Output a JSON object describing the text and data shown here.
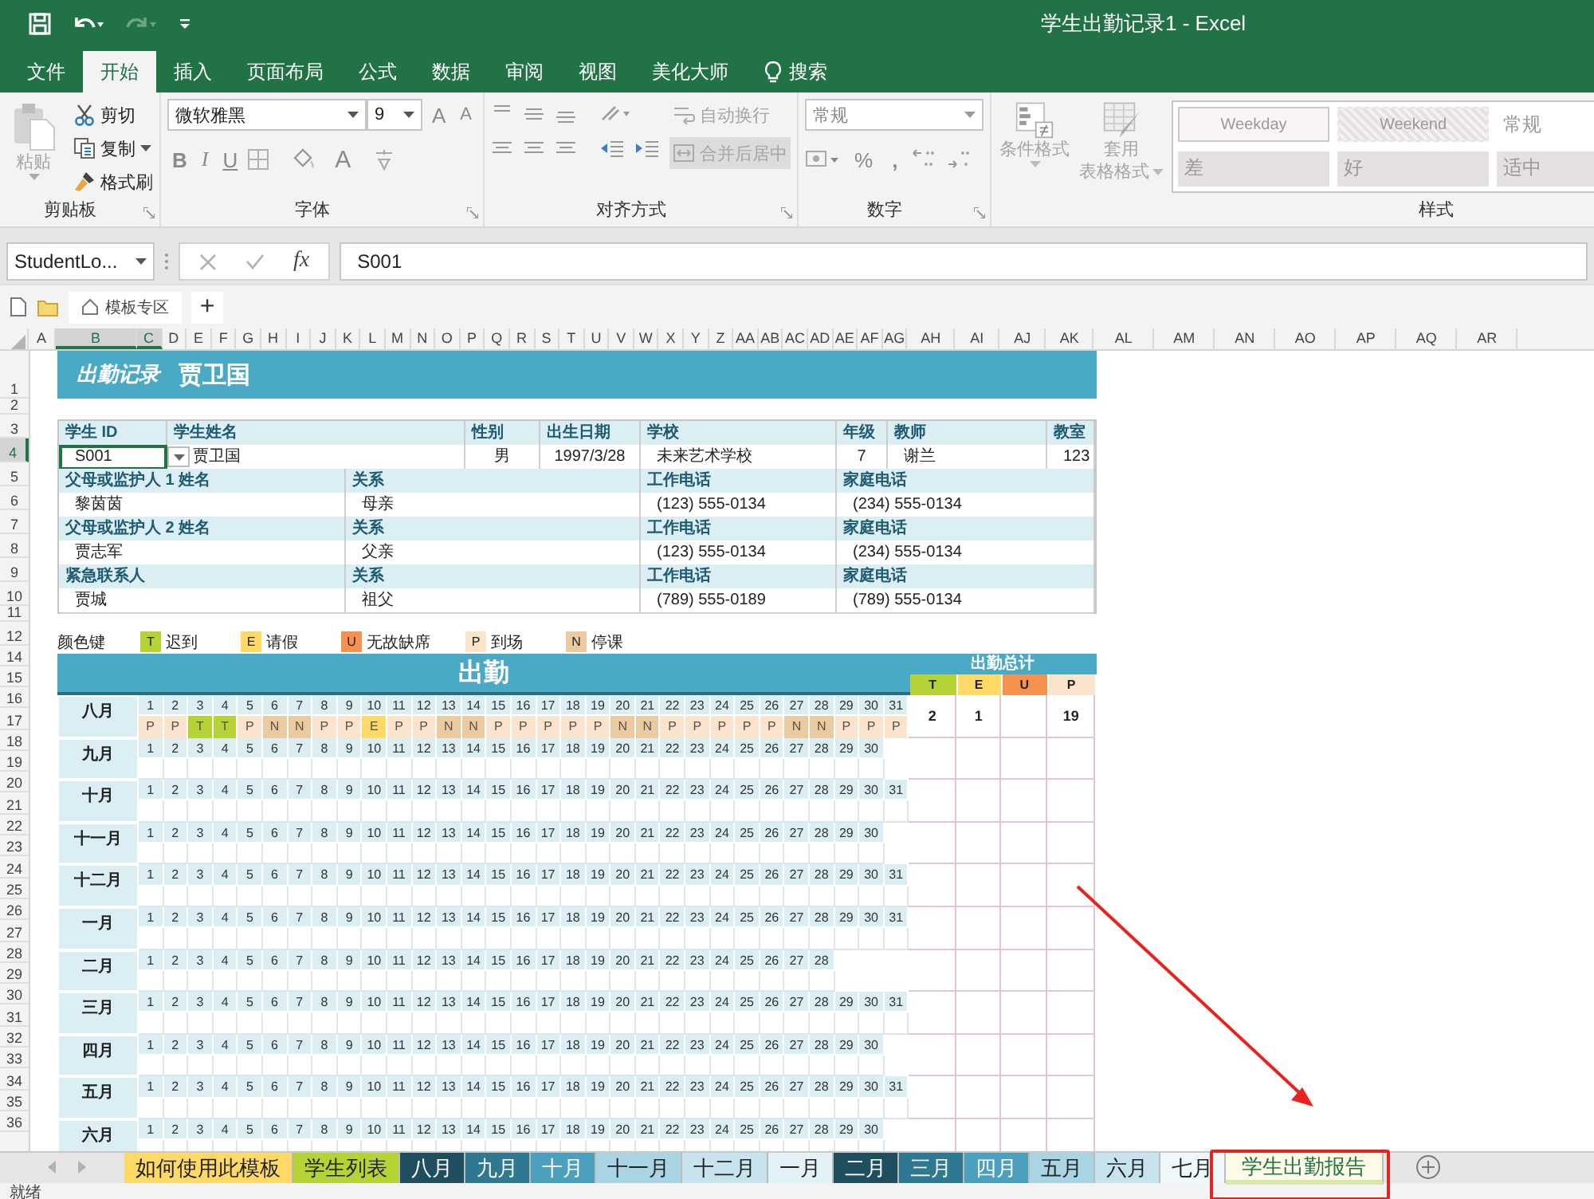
{
  "window": {
    "title": "学生出勤记录1  -  Excel"
  },
  "quick_access": [
    {
      "kind": "save",
      "disabled": false
    },
    {
      "kind": "undo",
      "disabled": false
    },
    {
      "kind": "redo",
      "disabled": true
    },
    {
      "kind": "customize",
      "disabled": false
    }
  ],
  "menu_tabs": [
    {
      "label": "文件",
      "kind": "tab",
      "selected": false
    },
    {
      "label": "开始",
      "kind": "tab",
      "selected": true
    },
    {
      "label": "插入",
      "kind": "tab",
      "selected": false
    },
    {
      "label": "页面布局",
      "kind": "tab",
      "selected": false
    },
    {
      "label": "公式",
      "kind": "tab",
      "selected": false
    },
    {
      "label": "数据",
      "kind": "tab",
      "selected": false
    },
    {
      "label": "审阅",
      "kind": "tab",
      "selected": false
    },
    {
      "label": "视图",
      "kind": "tab",
      "selected": false
    },
    {
      "label": "美化大师",
      "kind": "tab",
      "selected": false
    },
    {
      "label": "搜索",
      "kind": "search",
      "selected": false
    }
  ],
  "ribbon": {
    "clipboard": {
      "label": "剪贴板",
      "paste": {
        "label": "粘贴",
        "disabled": true
      },
      "items": [
        {
          "kind": "cut",
          "label": "剪切"
        },
        {
          "kind": "copy",
          "label": "复制"
        },
        {
          "kind": "painter",
          "label": "格式刷"
        }
      ]
    },
    "font": {
      "label": "字体",
      "font_name": "微软雅黑",
      "font_size": "9",
      "grow": "A",
      "shrink": "A",
      "bold": "B",
      "italic": "I",
      "underline": "U",
      "font_color": "A"
    },
    "alignment": {
      "label": "对齐方式",
      "buttons": [
        {
          "kind": "wrap",
          "label": "自动换行",
          "disabled": true
        },
        {
          "kind": "merge",
          "label": "合并后居中",
          "disabled": true
        }
      ]
    },
    "number": {
      "label": "数字",
      "format": "常规",
      "percent": "%",
      "comma": ","
    },
    "styles": {
      "label": "样式",
      "buttons": [
        {
          "kind": "conditional",
          "lines": [
            "条件格式"
          ],
          "disabled": true
        },
        {
          "kind": "table",
          "lines": [
            "套用",
            "表格格式"
          ],
          "disabled": true
        }
      ],
      "gallery": [
        {
          "label": "Weekday",
          "kind": "weekday"
        },
        {
          "label": "Weekend",
          "kind": "weekend"
        },
        {
          "label": "常规",
          "kind": "normal"
        },
        {
          "label": "差",
          "kind": "bad"
        },
        {
          "label": "好",
          "kind": "good"
        },
        {
          "label": "适中",
          "kind": "neutral"
        }
      ]
    }
  },
  "formula_bar": {
    "name_box": "StudentLo...",
    "fx": "fx",
    "value": "S001"
  },
  "template_bar": {
    "tab": "模板专区",
    "add": "+"
  },
  "columns": [
    {
      "label": "A",
      "selected": false
    },
    {
      "label": "B",
      "selected": true
    },
    {
      "label": "C",
      "selected": true
    },
    {
      "label": "D",
      "selected": false
    },
    {
      "label": "E",
      "selected": false
    },
    {
      "label": "F",
      "selected": false
    },
    {
      "label": "G",
      "selected": false
    },
    {
      "label": "H",
      "selected": false
    },
    {
      "label": "I",
      "selected": false
    },
    {
      "label": "J",
      "selected": false
    },
    {
      "label": "K",
      "selected": false
    },
    {
      "label": "L",
      "selected": false
    },
    {
      "label": "M",
      "selected": false
    },
    {
      "label": "N",
      "selected": false
    },
    {
      "label": "O",
      "selected": false
    },
    {
      "label": "P",
      "selected": false
    },
    {
      "label": "Q",
      "selected": false
    },
    {
      "label": "R",
      "selected": false
    },
    {
      "label": "S",
      "selected": false
    },
    {
      "label": "T",
      "selected": false
    },
    {
      "label": "U",
      "selected": false
    },
    {
      "label": "V",
      "selected": false
    },
    {
      "label": "W",
      "selected": false
    },
    {
      "label": "X",
      "selected": false
    },
    {
      "label": "Y",
      "selected": false
    },
    {
      "label": "Z",
      "selected": false
    },
    {
      "label": "AA",
      "selected": false
    },
    {
      "label": "AB",
      "selected": false
    },
    {
      "label": "AC",
      "selected": false
    },
    {
      "label": "AD",
      "selected": false
    },
    {
      "label": "AE",
      "selected": false
    },
    {
      "label": "AF",
      "selected": false
    },
    {
      "label": "AG",
      "selected": false
    },
    {
      "label": "AH",
      "selected": false
    },
    {
      "label": "AI",
      "selected": false
    },
    {
      "label": "AJ",
      "selected": false
    },
    {
      "label": "AK",
      "selected": false
    },
    {
      "label": "AL",
      "selected": false
    },
    {
      "label": "AM",
      "selected": false
    },
    {
      "label": "AN",
      "selected": false
    },
    {
      "label": "AO",
      "selected": false
    },
    {
      "label": "AP",
      "selected": false
    },
    {
      "label": "AQ",
      "selected": false
    },
    {
      "label": "AR",
      "selected": false
    }
  ],
  "rows": [
    {
      "label": "1",
      "selected": false
    },
    {
      "label": "2",
      "selected": false
    },
    {
      "label": "3",
      "selected": false
    },
    {
      "label": "4",
      "selected": true
    },
    {
      "label": "5",
      "selected": false
    },
    {
      "label": "6",
      "selected": false
    },
    {
      "label": "7",
      "selected": false
    },
    {
      "label": "8",
      "selected": false
    },
    {
      "label": "9",
      "selected": false
    },
    {
      "label": "10",
      "selected": false
    },
    {
      "label": "11",
      "selected": false
    },
    {
      "label": "12",
      "selected": false
    },
    {
      "label": "14",
      "selected": false
    },
    {
      "label": "15",
      "selected": false
    },
    {
      "label": "16",
      "selected": false
    },
    {
      "label": "17",
      "selected": false
    },
    {
      "label": "18",
      "selected": false
    },
    {
      "label": "19",
      "selected": false
    },
    {
      "label": "20",
      "selected": false
    },
    {
      "label": "21",
      "selected": false
    },
    {
      "label": "22",
      "selected": false
    },
    {
      "label": "23",
      "selected": false
    },
    {
      "label": "24",
      "selected": false
    },
    {
      "label": "25",
      "selected": false
    },
    {
      "label": "26",
      "selected": false
    },
    {
      "label": "27",
      "selected": false
    },
    {
      "label": "28",
      "selected": false
    },
    {
      "label": "29",
      "selected": false
    },
    {
      "label": "30",
      "selected": false
    },
    {
      "label": "31",
      "selected": false
    },
    {
      "label": "32",
      "selected": false
    },
    {
      "label": "33",
      "selected": false
    },
    {
      "label": "34",
      "selected": false
    },
    {
      "label": "35",
      "selected": false
    },
    {
      "label": "36",
      "selected": false
    }
  ],
  "sheet": {
    "title": {
      "heading": "出勤记录",
      "name": "贾卫国"
    },
    "student": {
      "labels": [
        "学生 ID",
        "学生姓名",
        "性别",
        "出生日期",
        "学校",
        "年级",
        "教师",
        "教室"
      ],
      "values": [
        {
          "text": "S001",
          "selected": true
        },
        {
          "text": "贾卫国",
          "selected": false
        },
        {
          "text": "男",
          "selected": false
        },
        {
          "text": "1997/3/28",
          "selected": false
        },
        {
          "text": "未来艺术学校",
          "selected": false
        },
        {
          "text": "7",
          "selected": false
        },
        {
          "text": "谢兰",
          "selected": false
        },
        {
          "text": "123",
          "selected": false
        }
      ]
    },
    "contacts": [
      {
        "labels": [
          "父母或监护人 1 姓名",
          "关系",
          "工作电话",
          "家庭电话"
        ],
        "values": [
          "黎茵茵",
          "母亲",
          "(123) 555-0134",
          "(234) 555-0134"
        ]
      },
      {
        "labels": [
          "父母或监护人 2 姓名",
          "关系",
          "工作电话",
          "家庭电话"
        ],
        "values": [
          "贾志军",
          "父亲",
          "(123) 555-0134",
          "(234) 555-0134"
        ]
      },
      {
        "labels": [
          "紧急联系人",
          "关系",
          "工作电话",
          "家庭电话"
        ],
        "values": [
          "贾城",
          "祖父",
          "(789) 555-0189",
          "(789) 555-0134"
        ]
      }
    ],
    "legend": {
      "label": "颜色键",
      "items": [
        {
          "code": "T",
          "label": "迟到",
          "kind": "late"
        },
        {
          "code": "E",
          "label": "请假",
          "kind": "excused"
        },
        {
          "code": "U",
          "label": "无故缺席",
          "kind": "absent"
        },
        {
          "code": "P",
          "label": "到场",
          "kind": "present"
        },
        {
          "code": "N",
          "label": "停课",
          "kind": "closed"
        }
      ]
    },
    "attendance": {
      "title": "出勤",
      "totals_title": "出勤总计",
      "totals_columns": [
        {
          "code": "T",
          "kind": "late"
        },
        {
          "code": "E",
          "kind": "excused"
        },
        {
          "code": "U",
          "kind": "absent"
        },
        {
          "code": "P",
          "kind": "present"
        }
      ],
      "months": [
        {
          "name": "八月",
          "days": [
            "1",
            "2",
            "3",
            "4",
            "5",
            "6",
            "7",
            "8",
            "9",
            "10",
            "11",
            "12",
            "13",
            "14",
            "15",
            "16",
            "17",
            "18",
            "19",
            "20",
            "21",
            "22",
            "23",
            "24",
            "25",
            "26",
            "27",
            "28",
            "29",
            "30",
            "31"
          ],
          "marks": [
            {
              "code": "P",
              "kind": "present"
            },
            {
              "code": "P",
              "kind": "present"
            },
            {
              "code": "T",
              "kind": "late"
            },
            {
              "code": "T",
              "kind": "late"
            },
            {
              "code": "P",
              "kind": "present"
            },
            {
              "code": "N",
              "kind": "closed"
            },
            {
              "code": "N",
              "kind": "closed"
            },
            {
              "code": "P",
              "kind": "present"
            },
            {
              "code": "P",
              "kind": "present"
            },
            {
              "code": "E",
              "kind": "excused"
            },
            {
              "code": "P",
              "kind": "present"
            },
            {
              "code": "P",
              "kind": "present"
            },
            {
              "code": "N",
              "kind": "closed"
            },
            {
              "code": "N",
              "kind": "closed"
            },
            {
              "code": "P",
              "kind": "present"
            },
            {
              "code": "P",
              "kind": "present"
            },
            {
              "code": "P",
              "kind": "present"
            },
            {
              "code": "P",
              "kind": "present"
            },
            {
              "code": "P",
              "kind": "present"
            },
            {
              "code": "N",
              "kind": "closed"
            },
            {
              "code": "N",
              "kind": "closed"
            },
            {
              "code": "P",
              "kind": "present"
            },
            {
              "code": "P",
              "kind": "present"
            },
            {
              "code": "P",
              "kind": "present"
            },
            {
              "code": "P",
              "kind": "present"
            },
            {
              "code": "P",
              "kind": "present"
            },
            {
              "code": "N",
              "kind": "closed"
            },
            {
              "code": "N",
              "kind": "closed"
            },
            {
              "code": "P",
              "kind": "present"
            },
            {
              "code": "P",
              "kind": "present"
            },
            {
              "code": "P",
              "kind": "present"
            }
          ],
          "totals": [
            {
              "kind": "late",
              "value": "2"
            },
            {
              "kind": "excused",
              "value": "1"
            },
            {
              "kind": "present",
              "value": "19"
            }
          ]
        },
        {
          "name": "九月",
          "days": [
            "1",
            "2",
            "3",
            "4",
            "5",
            "6",
            "7",
            "8",
            "9",
            "10",
            "11",
            "12",
            "13",
            "14",
            "15",
            "16",
            "17",
            "18",
            "19",
            "20",
            "21",
            "22",
            "23",
            "24",
            "25",
            "26",
            "27",
            "28",
            "29",
            "30"
          ]
        },
        {
          "name": "十月",
          "days": [
            "1",
            "2",
            "3",
            "4",
            "5",
            "6",
            "7",
            "8",
            "9",
            "10",
            "11",
            "12",
            "13",
            "14",
            "15",
            "16",
            "17",
            "18",
            "19",
            "20",
            "21",
            "22",
            "23",
            "24",
            "25",
            "26",
            "27",
            "28",
            "29",
            "30",
            "31"
          ]
        },
        {
          "name": "十一月",
          "days": [
            "1",
            "2",
            "3",
            "4",
            "5",
            "6",
            "7",
            "8",
            "9",
            "10",
            "11",
            "12",
            "13",
            "14",
            "15",
            "16",
            "17",
            "18",
            "19",
            "20",
            "21",
            "22",
            "23",
            "24",
            "25",
            "26",
            "27",
            "28",
            "29",
            "30"
          ]
        },
        {
          "name": "十二月",
          "days": [
            "1",
            "2",
            "3",
            "4",
            "5",
            "6",
            "7",
            "8",
            "9",
            "10",
            "11",
            "12",
            "13",
            "14",
            "15",
            "16",
            "17",
            "18",
            "19",
            "20",
            "21",
            "22",
            "23",
            "24",
            "25",
            "26",
            "27",
            "28",
            "29",
            "30",
            "31"
          ]
        },
        {
          "name": "一月",
          "days": [
            "1",
            "2",
            "3",
            "4",
            "5",
            "6",
            "7",
            "8",
            "9",
            "10",
            "11",
            "12",
            "13",
            "14",
            "15",
            "16",
            "17",
            "18",
            "19",
            "20",
            "21",
            "22",
            "23",
            "24",
            "25",
            "26",
            "27",
            "28",
            "29",
            "30",
            "31"
          ]
        },
        {
          "name": "二月",
          "days": [
            "1",
            "2",
            "3",
            "4",
            "5",
            "6",
            "7",
            "8",
            "9",
            "10",
            "11",
            "12",
            "13",
            "14",
            "15",
            "16",
            "17",
            "18",
            "19",
            "20",
            "21",
            "22",
            "23",
            "24",
            "25",
            "26",
            "27",
            "28"
          ]
        },
        {
          "name": "三月",
          "days": [
            "1",
            "2",
            "3",
            "4",
            "5",
            "6",
            "7",
            "8",
            "9",
            "10",
            "11",
            "12",
            "13",
            "14",
            "15",
            "16",
            "17",
            "18",
            "19",
            "20",
            "21",
            "22",
            "23",
            "24",
            "25",
            "26",
            "27",
            "28",
            "29",
            "30",
            "31"
          ]
        },
        {
          "name": "四月",
          "days": [
            "1",
            "2",
            "3",
            "4",
            "5",
            "6",
            "7",
            "8",
            "9",
            "10",
            "11",
            "12",
            "13",
            "14",
            "15",
            "16",
            "17",
            "18",
            "19",
            "20",
            "21",
            "22",
            "23",
            "24",
            "25",
            "26",
            "27",
            "28",
            "29",
            "30"
          ]
        },
        {
          "name": "五月",
          "days": [
            "1",
            "2",
            "3",
            "4",
            "5",
            "6",
            "7",
            "8",
            "9",
            "10",
            "11",
            "12",
            "13",
            "14",
            "15",
            "16",
            "17",
            "18",
            "19",
            "20",
            "21",
            "22",
            "23",
            "24",
            "25",
            "26",
            "27",
            "28",
            "29",
            "30",
            "31"
          ]
        },
        {
          "name": "六月",
          "days": [
            "1",
            "2",
            "3",
            "4",
            "5",
            "6",
            "7",
            "8",
            "9",
            "10",
            "11",
            "12",
            "13",
            "14",
            "15",
            "16",
            "17",
            "18",
            "19",
            "20",
            "21",
            "22",
            "23",
            "24",
            "25",
            "26",
            "27",
            "28",
            "29",
            "30"
          ]
        }
      ]
    }
  },
  "sheet_tabs": [
    {
      "label": "如何使用此模板",
      "color": "#ffd966",
      "selected": false
    },
    {
      "label": "学生列表",
      "color": "#b5d334",
      "selected": false
    },
    {
      "label": "八月",
      "color": "#1f4e5f",
      "selected": false
    },
    {
      "label": "九月",
      "color": "#2e7891",
      "selected": false
    },
    {
      "label": "十月",
      "color": "#4aa0bd",
      "selected": false
    },
    {
      "label": "十一月",
      "color": "#a8d4e4",
      "selected": false
    },
    {
      "label": "十二月",
      "color": "#c7e3ee",
      "selected": false
    },
    {
      "label": "一月",
      "color": "#e3f2f7",
      "selected": false
    },
    {
      "label": "二月",
      "color": "#1f4e5f",
      "selected": false
    },
    {
      "label": "三月",
      "color": "#2e7891",
      "selected": false
    },
    {
      "label": "四月",
      "color": "#4aa0bd",
      "selected": false
    },
    {
      "label": "五月",
      "color": "#a8d4e4",
      "selected": false
    },
    {
      "label": "六月",
      "color": "#c7e3ee",
      "selected": false
    },
    {
      "label": "七月",
      "color": "#eef7fa",
      "selected": false
    },
    {
      "label": "学生出勤报告",
      "color": "#d9e8a8",
      "selected": true
    }
  ],
  "status_bar": {
    "text": "就绪"
  }
}
